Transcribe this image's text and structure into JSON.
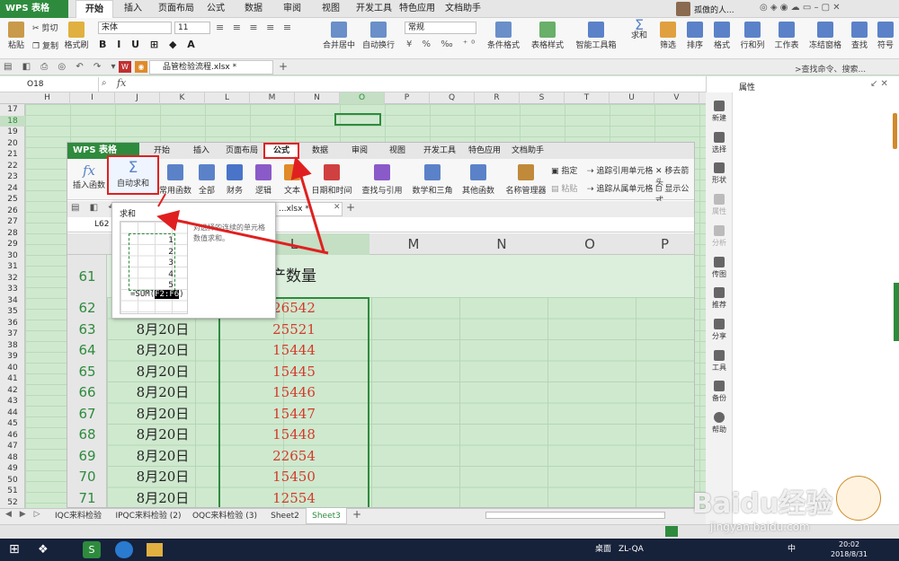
{
  "app": {
    "wps_button": "WPS 表格",
    "user": "孤傲的人..."
  },
  "main_tabs": [
    "开始",
    "插入",
    "页面布局",
    "公式",
    "数据",
    "审阅",
    "视图",
    "开发工具",
    "特色应用",
    "文档助手"
  ],
  "ribbon": {
    "paste": "粘贴",
    "cut": "剪切",
    "copy": "复制",
    "format_painter": "格式刷",
    "font_name": "宋体",
    "font_size": "11",
    "merge": "合并居中",
    "wrap": "自动换行",
    "number_format": "常规",
    "cond_format": "条件格式",
    "table_style": "表格样式",
    "smart_toolbox": "智能工具箱",
    "sum": "求和",
    "filter": "筛选",
    "sort": "排序",
    "format": "格式",
    "rows_cols": "行和列",
    "worksheet": "工作表",
    "freeze": "冻结窗格",
    "find": "查找",
    "symbol": "符号"
  },
  "file_tab": "品管检验流程.xlsx *",
  "search_hint": ">查找命令、搜索...",
  "name_box": "O18",
  "fx": "fx",
  "columns": [
    "H",
    "I",
    "J",
    "K",
    "L",
    "M",
    "N",
    "O",
    "P",
    "Q",
    "R",
    "S",
    "T",
    "U",
    "V"
  ],
  "rows": [
    "17",
    "18",
    "19",
    "20",
    "21",
    "22",
    "23",
    "24",
    "25",
    "26",
    "27",
    "28",
    "29",
    "30",
    "31",
    "32",
    "33",
    "34",
    "35",
    "36",
    "37",
    "38",
    "39",
    "40",
    "41",
    "42",
    "43",
    "44",
    "45",
    "46",
    "47",
    "48",
    "49",
    "50",
    "51",
    "52"
  ],
  "right_panel": {
    "title": "属性",
    "tools": [
      "新建",
      "选择",
      "形状",
      "属性",
      "分析",
      "传图",
      "推荐",
      "分享",
      "工具",
      "备份",
      "帮助"
    ]
  },
  "inner": {
    "wps_button": "WPS 表格",
    "tabs": [
      "开始",
      "插入",
      "页面布局",
      "公式",
      "数据",
      "审阅",
      "视图",
      "开发工具",
      "特色应用",
      "文档助手"
    ],
    "ribbon": [
      "插入函数",
      "自动求和",
      "常用函数",
      "全部",
      "财务",
      "逻辑",
      "文本",
      "日期和时间",
      "查找与引用",
      "数学和三角",
      "其他函数",
      "名称管理器"
    ],
    "small": {
      "specify": "指定",
      "paste": "粘贴",
      "trace_precedents": "追踪引用单元格",
      "trace_dependents": "追踪从属单元格",
      "remove_arrows": "移去箭头",
      "show_formulas": "显示公式"
    },
    "file_tab": "...xlsx *",
    "name_box": "L62",
    "col_headers": [
      "L",
      "M",
      "N",
      "O",
      "P"
    ],
    "header_text": "产数量",
    "rows": [
      {
        "num": "61",
        "date": "",
        "value": ""
      },
      {
        "num": "62",
        "date": "",
        "value": "26542"
      },
      {
        "num": "63",
        "date": "8月20日",
        "value": "25521"
      },
      {
        "num": "64",
        "date": "8月20日",
        "value": "15444"
      },
      {
        "num": "65",
        "date": "8月20日",
        "value": "15445"
      },
      {
        "num": "66",
        "date": "8月20日",
        "value": "15446"
      },
      {
        "num": "67",
        "date": "8月20日",
        "value": "15447"
      },
      {
        "num": "68",
        "date": "8月20日",
        "value": "15448"
      },
      {
        "num": "69",
        "date": "8月20日",
        "value": "22654"
      },
      {
        "num": "70",
        "date": "8月20日",
        "value": "15450"
      },
      {
        "num": "71",
        "date": "8月20日",
        "value": "12554"
      }
    ]
  },
  "tooltip": {
    "title": "求和",
    "desc": "对选择的连续的单元格数值求和。",
    "nums": [
      "1",
      "2",
      "3",
      "4",
      "5"
    ],
    "formula_prefix": "=SUM(",
    "formula_range": "F2:F6",
    "formula_suffix": ")"
  },
  "sheet_tabs": [
    "IQC来料检验",
    "IPQC来料检验 (2)",
    "OQC来料检验 (3)",
    "Sheet2",
    "Sheet3"
  ],
  "taskbar": {
    "desktop": "桌面",
    "zl": "ZL-QA",
    "time": "20:02",
    "date": "2018/8/31",
    "ime": "中"
  },
  "watermark": "Baidu经验",
  "watermark_url": "jingyan.baidu.com",
  "colors": {
    "accent": "#2e8b3d",
    "highlight": "#e02020",
    "cell_green": "#cfe9cf"
  }
}
